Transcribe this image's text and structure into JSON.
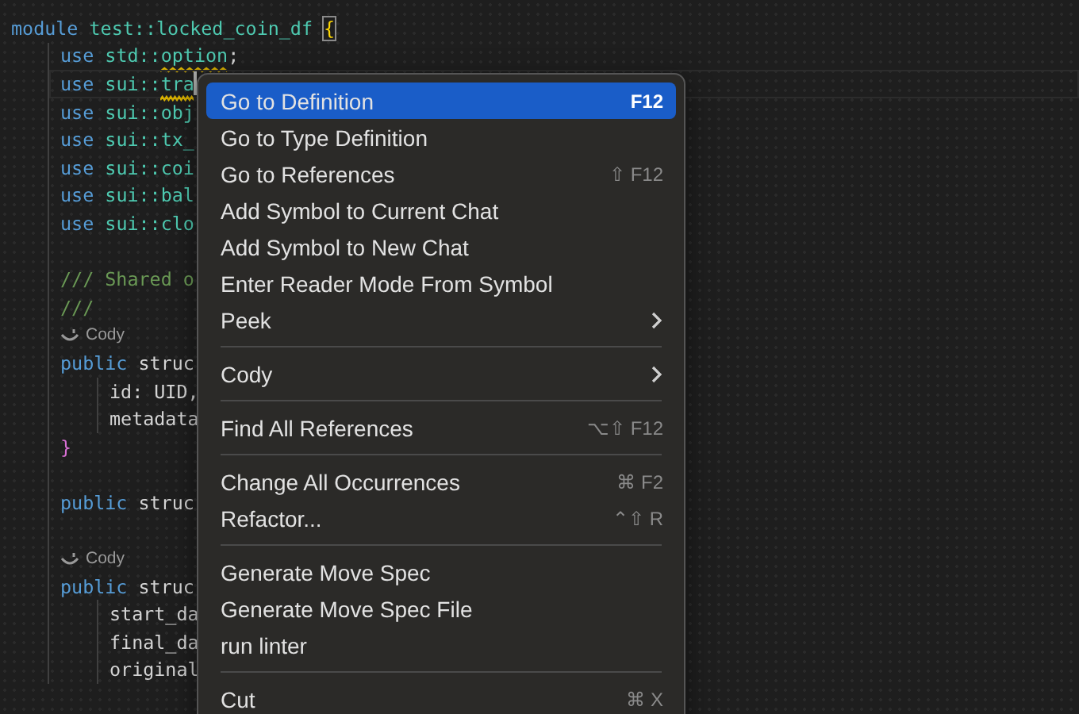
{
  "editor": {
    "lines": [
      {
        "kind": "code",
        "tokens": [
          {
            "kind": "keyword",
            "text": "module"
          },
          {
            "kind": "type",
            "text": " test::locked_coin_df "
          },
          {
            "kind": "bracket",
            "text": "{",
            "matched": true
          }
        ],
        "children": [
          {
            "kind": "code",
            "tokens": [
              {
                "kind": "keyword",
                "text": "use"
              },
              {
                "kind": "type",
                "text": " std::"
              },
              {
                "kind": "type",
                "text": "option",
                "warning": true
              },
              {
                "kind": "plain",
                "text": ";"
              }
            ]
          },
          {
            "kind": "code",
            "current": true,
            "cursor": true,
            "tokens": [
              {
                "kind": "keyword",
                "text": "use"
              },
              {
                "kind": "type",
                "text": " sui::"
              },
              {
                "kind": "type",
                "text": "tra",
                "warning": true
              }
            ]
          },
          {
            "kind": "code",
            "tokens": [
              {
                "kind": "keyword",
                "text": "use"
              },
              {
                "kind": "type",
                "text": " sui::obj"
              }
            ]
          },
          {
            "kind": "code",
            "tokens": [
              {
                "kind": "keyword",
                "text": "use"
              },
              {
                "kind": "type",
                "text": " sui::tx_"
              }
            ]
          },
          {
            "kind": "code",
            "tokens": [
              {
                "kind": "keyword",
                "text": "use"
              },
              {
                "kind": "type",
                "text": " sui::coi"
              }
            ]
          },
          {
            "kind": "code",
            "tokens": [
              {
                "kind": "keyword",
                "text": "use"
              },
              {
                "kind": "type",
                "text": " sui::bal"
              }
            ]
          },
          {
            "kind": "code",
            "tokens": [
              {
                "kind": "keyword",
                "text": "use"
              },
              {
                "kind": "type",
                "text": " sui::clo"
              }
            ]
          },
          {
            "kind": "blank"
          },
          {
            "kind": "code",
            "tokens": [
              {
                "kind": "comment",
                "text": "/// Shared o"
              }
            ]
          },
          {
            "kind": "code",
            "tokens": [
              {
                "kind": "comment",
                "text": "///"
              }
            ]
          },
          {
            "kind": "lens",
            "text": "Cody"
          },
          {
            "kind": "code",
            "tokens": [
              {
                "kind": "keyword",
                "text": "public"
              },
              {
                "kind": "plain",
                "text": " struc"
              }
            ],
            "children": [
              {
                "kind": "code",
                "tokens": [
                  {
                    "kind": "plain",
                    "text": "id: UID,"
                  }
                ]
              },
              {
                "kind": "code",
                "tokens": [
                  {
                    "kind": "plain",
                    "text": "metadata"
                  }
                ]
              }
            ]
          },
          {
            "kind": "code",
            "tokens": [
              {
                "kind": "bracket-pink",
                "text": "}"
              }
            ]
          },
          {
            "kind": "blank"
          },
          {
            "kind": "code",
            "tokens": [
              {
                "kind": "keyword",
                "text": "public"
              },
              {
                "kind": "plain",
                "text": " struc"
              }
            ]
          },
          {
            "kind": "blank"
          },
          {
            "kind": "lens",
            "text": "Cody"
          },
          {
            "kind": "code",
            "tokens": [
              {
                "kind": "keyword",
                "text": "public"
              },
              {
                "kind": "plain",
                "text": " struc"
              }
            ],
            "children": [
              {
                "kind": "code",
                "tokens": [
                  {
                    "kind": "plain",
                    "text": "start_da"
                  }
                ]
              },
              {
                "kind": "code",
                "tokens": [
                  {
                    "kind": "plain",
                    "text": "final_da"
                  }
                ]
              },
              {
                "kind": "code",
                "tokens": [
                  {
                    "kind": "plain",
                    "text": "original"
                  }
                ]
              }
            ]
          }
        ]
      }
    ]
  },
  "context_menu": {
    "items": [
      {
        "kind": "item",
        "label": "Go to Definition",
        "shortcut": "F12",
        "selected": true,
        "submenu": false
      },
      {
        "kind": "item",
        "label": "Go to Type Definition",
        "selected": false,
        "submenu": false
      },
      {
        "kind": "item",
        "label": "Go to References",
        "shortcut": "⇧ F12",
        "selected": false,
        "submenu": false
      },
      {
        "kind": "item",
        "label": "Add Symbol to Current Chat",
        "selected": false,
        "submenu": false
      },
      {
        "kind": "item",
        "label": "Add Symbol to New Chat",
        "selected": false,
        "submenu": false
      },
      {
        "kind": "item",
        "label": "Enter Reader Mode From Symbol",
        "selected": false,
        "submenu": false
      },
      {
        "kind": "item",
        "label": "Peek",
        "selected": false,
        "submenu": true
      },
      {
        "kind": "separator"
      },
      {
        "kind": "item",
        "label": "Cody",
        "selected": false,
        "submenu": true
      },
      {
        "kind": "separator"
      },
      {
        "kind": "item",
        "label": "Find All References",
        "shortcut": "⌥⇧ F12",
        "selected": false,
        "submenu": false
      },
      {
        "kind": "separator"
      },
      {
        "kind": "item",
        "label": "Change All Occurrences",
        "shortcut": "⌘ F2",
        "selected": false,
        "submenu": false
      },
      {
        "kind": "item",
        "label": "Refactor...",
        "shortcut": "⌃⇧ R",
        "selected": false,
        "submenu": false
      },
      {
        "kind": "separator"
      },
      {
        "kind": "item",
        "label": "Generate Move Spec",
        "selected": false,
        "submenu": false
      },
      {
        "kind": "item",
        "label": "Generate Move Spec File",
        "selected": false,
        "submenu": false
      },
      {
        "kind": "item",
        "label": "run linter",
        "selected": false,
        "submenu": false
      },
      {
        "kind": "separator"
      },
      {
        "kind": "item",
        "label": "Cut",
        "shortcut": "⌘ X",
        "selected": false,
        "submenu": false
      }
    ]
  }
}
